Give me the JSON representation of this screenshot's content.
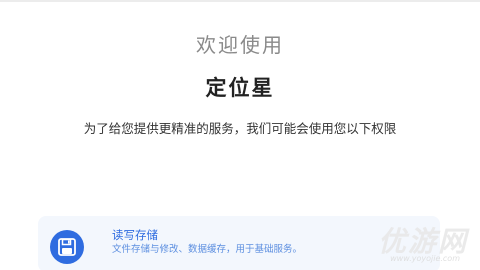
{
  "welcome": "欢迎使用",
  "app_name": "定位星",
  "description": "为了给您提供更精准的服务，我们可能会使用您以下权限",
  "permissions": [
    {
      "title": "读写存储",
      "desc": "文件存储与修改、数据缓存，用于基础服务。",
      "icon": "floppy-disk-icon"
    }
  ],
  "watermark": {
    "text": "优游网",
    "url": "www.yoyojie.com"
  },
  "colors": {
    "accent": "#2f6ce0",
    "card_bg": "#f3f7fd",
    "welcome_text": "#8a8a8a"
  }
}
